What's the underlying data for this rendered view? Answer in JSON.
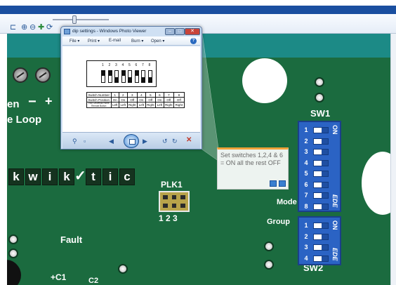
{
  "viewer": {
    "title": "dip settings - Windows Photo Viewer",
    "menu": [
      {
        "label": "File ▾"
      },
      {
        "label": "Print ▾"
      },
      {
        "label": "E-mail"
      },
      {
        "label": "Burn ▾"
      },
      {
        "label": "Open ▾"
      }
    ],
    "help": "?",
    "diagram": {
      "top_numbers": [
        "1",
        "2",
        "3",
        "4",
        "5",
        "6",
        "7",
        "8"
      ],
      "table": {
        "row_switch_number": [
          "Switch Number",
          "1",
          "2",
          "3",
          "4",
          "5",
          "6",
          "7",
          "8"
        ],
        "row_switch_position": [
          "Switch Position",
          "On",
          "On",
          "Off",
          "On",
          "Off",
          "On",
          "Off",
          "Off"
        ],
        "row_remote_button": [
          "Your Universal Home Remote Button",
          "Left",
          "Left",
          "Right",
          "Left",
          "Right",
          "Left",
          "Right",
          "Right"
        ]
      }
    }
  },
  "board": {
    "labels": {
      "en": "en",
      "minus": "−",
      "plus": "+",
      "e_loop": "e Loop",
      "kwik": [
        "k",
        "w",
        "i",
        "k"
      ],
      "check": "✓",
      "tic": [
        "t",
        "i",
        "c"
      ],
      "plk1": "PLK1",
      "plk_pins": "1 2 3",
      "sw1": "SW1",
      "mode": "Mode",
      "group": "Group",
      "fault": "Fault",
      "sw2": "SW2",
      "c1": "+C1",
      "c2": "C2"
    },
    "sw1": {
      "numbers": [
        "1",
        "2",
        "3",
        "4",
        "5",
        "6",
        "7",
        "8"
      ],
      "on_label": "ON",
      "brand_label": "EDE"
    },
    "sw2": {
      "numbers": [
        "1",
        "2",
        "3",
        "4"
      ],
      "on_label": "ON",
      "brand_label": "EDE"
    }
  },
  "tooltip": {
    "text": "Set switches 1,2,4 & 6 = ON all the rest OFF"
  }
}
